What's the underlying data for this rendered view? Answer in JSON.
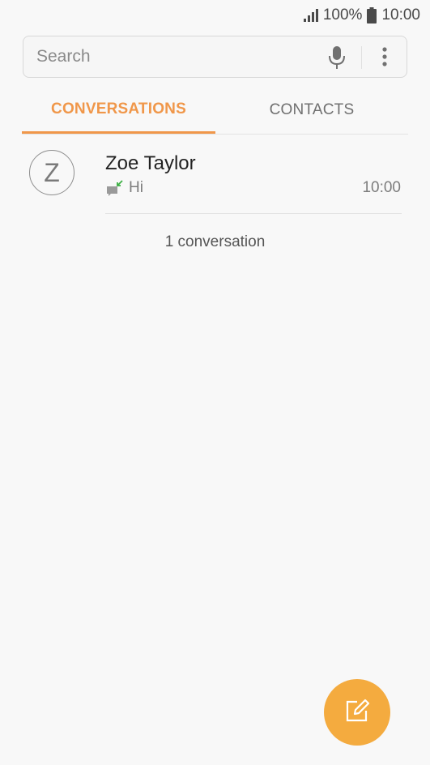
{
  "status_bar": {
    "battery": "100%",
    "time": "10:00",
    "icons": [
      "signal-icon",
      "battery-icon"
    ]
  },
  "search": {
    "placeholder": "Search",
    "value": "",
    "icons": [
      "microphone-icon",
      "more-options-icon"
    ]
  },
  "tabs": [
    {
      "label": "CONVERSATIONS",
      "active": true
    },
    {
      "label": "CONTACTS",
      "active": false
    }
  ],
  "conversations": [
    {
      "avatar_letter": "Z",
      "name": "Zoe Taylor",
      "preview": "Hi",
      "time": "10:00",
      "icon": "incoming-message-icon"
    }
  ],
  "conversation_count": "1 conversation",
  "fab": {
    "icon": "compose-icon"
  },
  "colors": {
    "accent": "#f0974a",
    "fab": "#f4ab3f",
    "background": "#f8f8f8",
    "incoming_arrow": "#3cb043"
  }
}
